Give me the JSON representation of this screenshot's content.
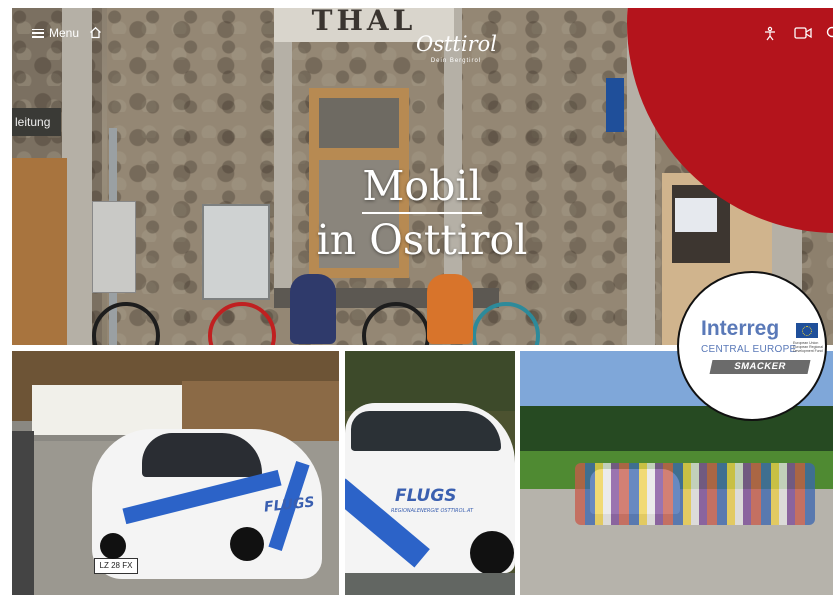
{
  "nav": {
    "menu_label": "Menu",
    "icons": [
      "menu-icon",
      "home-icon",
      "accessibility-icon",
      "video-icon",
      "search-icon"
    ]
  },
  "hero": {
    "sign_text": "THAL",
    "left_sign_text": "leitung",
    "logo_word": "Osttirol",
    "logo_sub": "Dein Bergtirol",
    "title_line1": "Mobil",
    "title_line2": "in Osttirol"
  },
  "badge": {
    "brand": "Interreg",
    "region": "CENTRAL EUROPE",
    "eu_text": "European Union European Regional Development Fund",
    "project": "SMACKER"
  },
  "photos": {
    "car1_text": "FLUGS",
    "car1_plate": "LZ 28 FX",
    "car2_text": "FLUGS",
    "car2_sub": "REGIONALENERGIE OSTTIROL.AT"
  },
  "colors": {
    "brand_red": "#b4141c",
    "interreg_blue": "#5a79b8",
    "eu_blue": "#1f4f9a",
    "flugs_blue": "#2c63c8"
  }
}
